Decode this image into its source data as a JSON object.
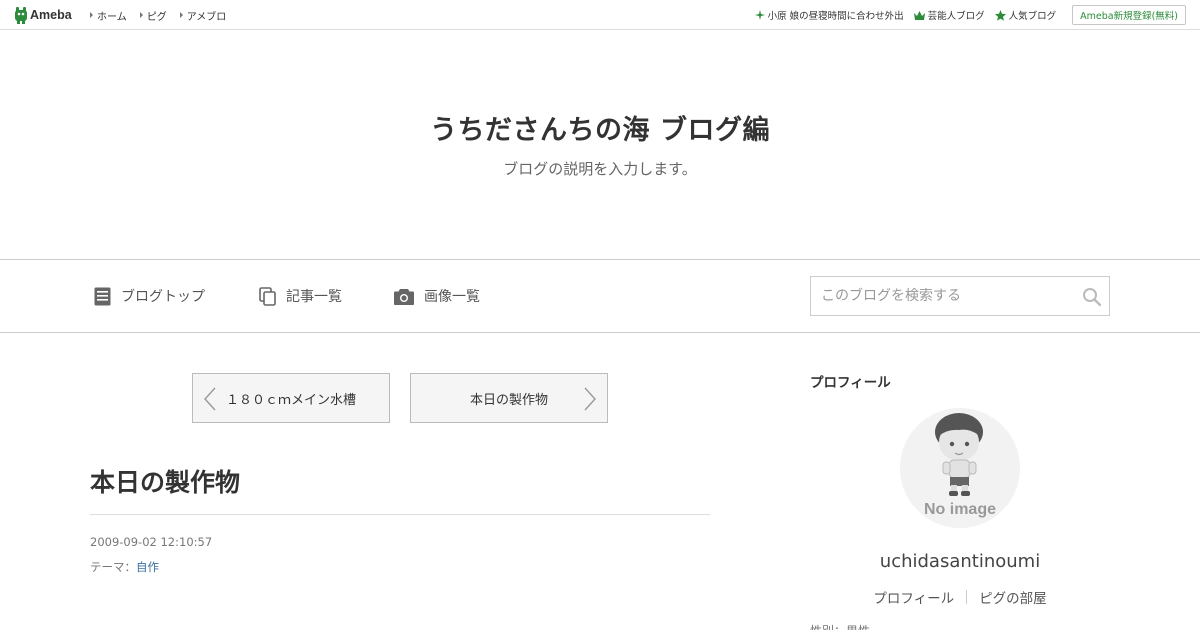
{
  "topbar": {
    "logo_text": "Ameba",
    "nav": [
      {
        "label": "ホーム"
      },
      {
        "label": "ピグ"
      },
      {
        "label": "アメブロ"
      }
    ],
    "right": {
      "news_label": "小原 娘の昼寝時間に合わせ外出",
      "talent_label": "芸能人ブログ",
      "popular_label": "人気ブログ",
      "register_label": "Ameba新規登録(無料)"
    }
  },
  "header": {
    "title": "うちださんちの海 ブログ編",
    "description": "ブログの説明を入力します。"
  },
  "blognav": {
    "top_label": "ブログトップ",
    "entries_label": "記事一覧",
    "images_label": "画像一覧",
    "search_placeholder": "このブログを検索する"
  },
  "pager": {
    "prev_label": "１８０ｃｍメイン水槽",
    "next_label": "本日の製作物"
  },
  "entry": {
    "title": "本日の製作物",
    "date": "2009-09-02 12:10:57",
    "theme_prefix": "テーマ：",
    "theme_link": "自作"
  },
  "sidebar": {
    "heading": "プロフィール",
    "avatar_text": "No image",
    "username": "uchidasantinoumi",
    "links": [
      {
        "label": "プロフィール"
      },
      {
        "label": "ピグの部屋"
      }
    ],
    "cutoff_text": "性別：男性"
  },
  "colors": {
    "brand_green": "#2d8c3c",
    "link_blue": "#3a6ea5",
    "border": "#cccccc"
  }
}
